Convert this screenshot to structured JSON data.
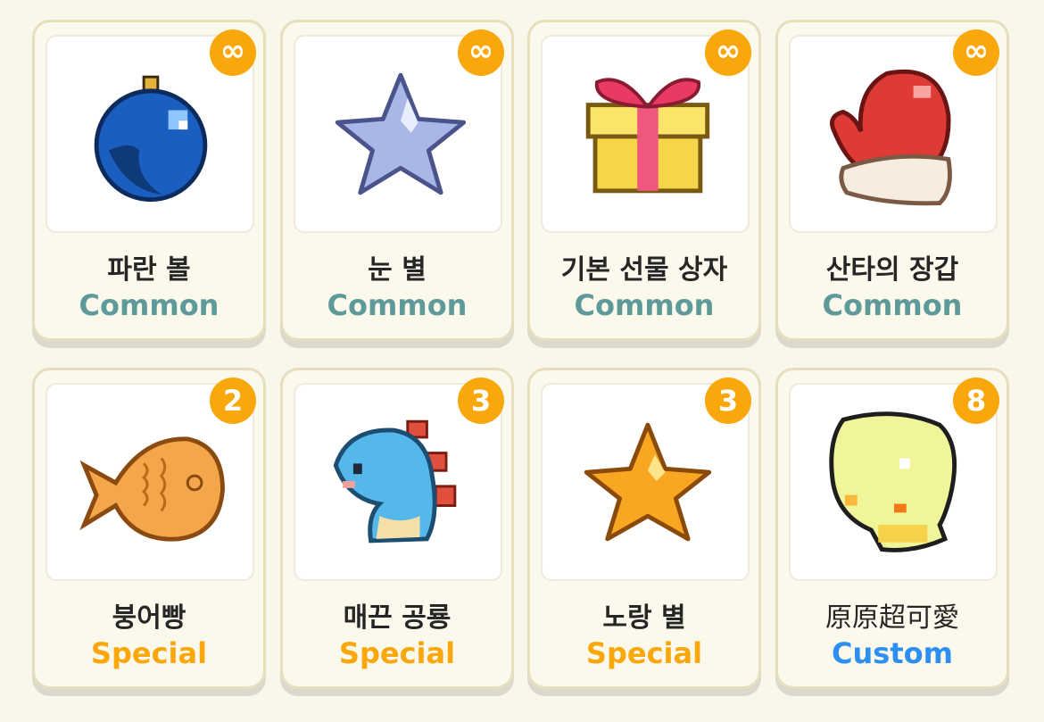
{
  "colors": {
    "common": "#5e9a99",
    "special": "#f9a70b",
    "custom": "#2c8ff1",
    "badge": "#f9a70b",
    "background": "#f9f6ea"
  },
  "items": [
    {
      "name": "파란 볼",
      "rarity": "Common",
      "count": "∞",
      "icon": "blue-ornament-ball-icon"
    },
    {
      "name": "눈 별",
      "rarity": "Common",
      "count": "∞",
      "icon": "snow-star-icon"
    },
    {
      "name": "기본 선물 상자",
      "rarity": "Common",
      "count": "∞",
      "icon": "gift-box-icon"
    },
    {
      "name": "산타의 장갑",
      "rarity": "Common",
      "count": "∞",
      "icon": "santa-mitten-icon"
    },
    {
      "name": "붕어빵",
      "rarity": "Special",
      "count": "2",
      "icon": "fish-bread-icon"
    },
    {
      "name": "매끈 공룡",
      "rarity": "Special",
      "count": "3",
      "icon": "blue-dinosaur-icon"
    },
    {
      "name": "노랑 별",
      "rarity": "Special",
      "count": "3",
      "icon": "yellow-star-icon"
    },
    {
      "name": "原原超可愛",
      "rarity": "Custom",
      "count": "8",
      "icon": "yellow-bubble-icon"
    }
  ]
}
